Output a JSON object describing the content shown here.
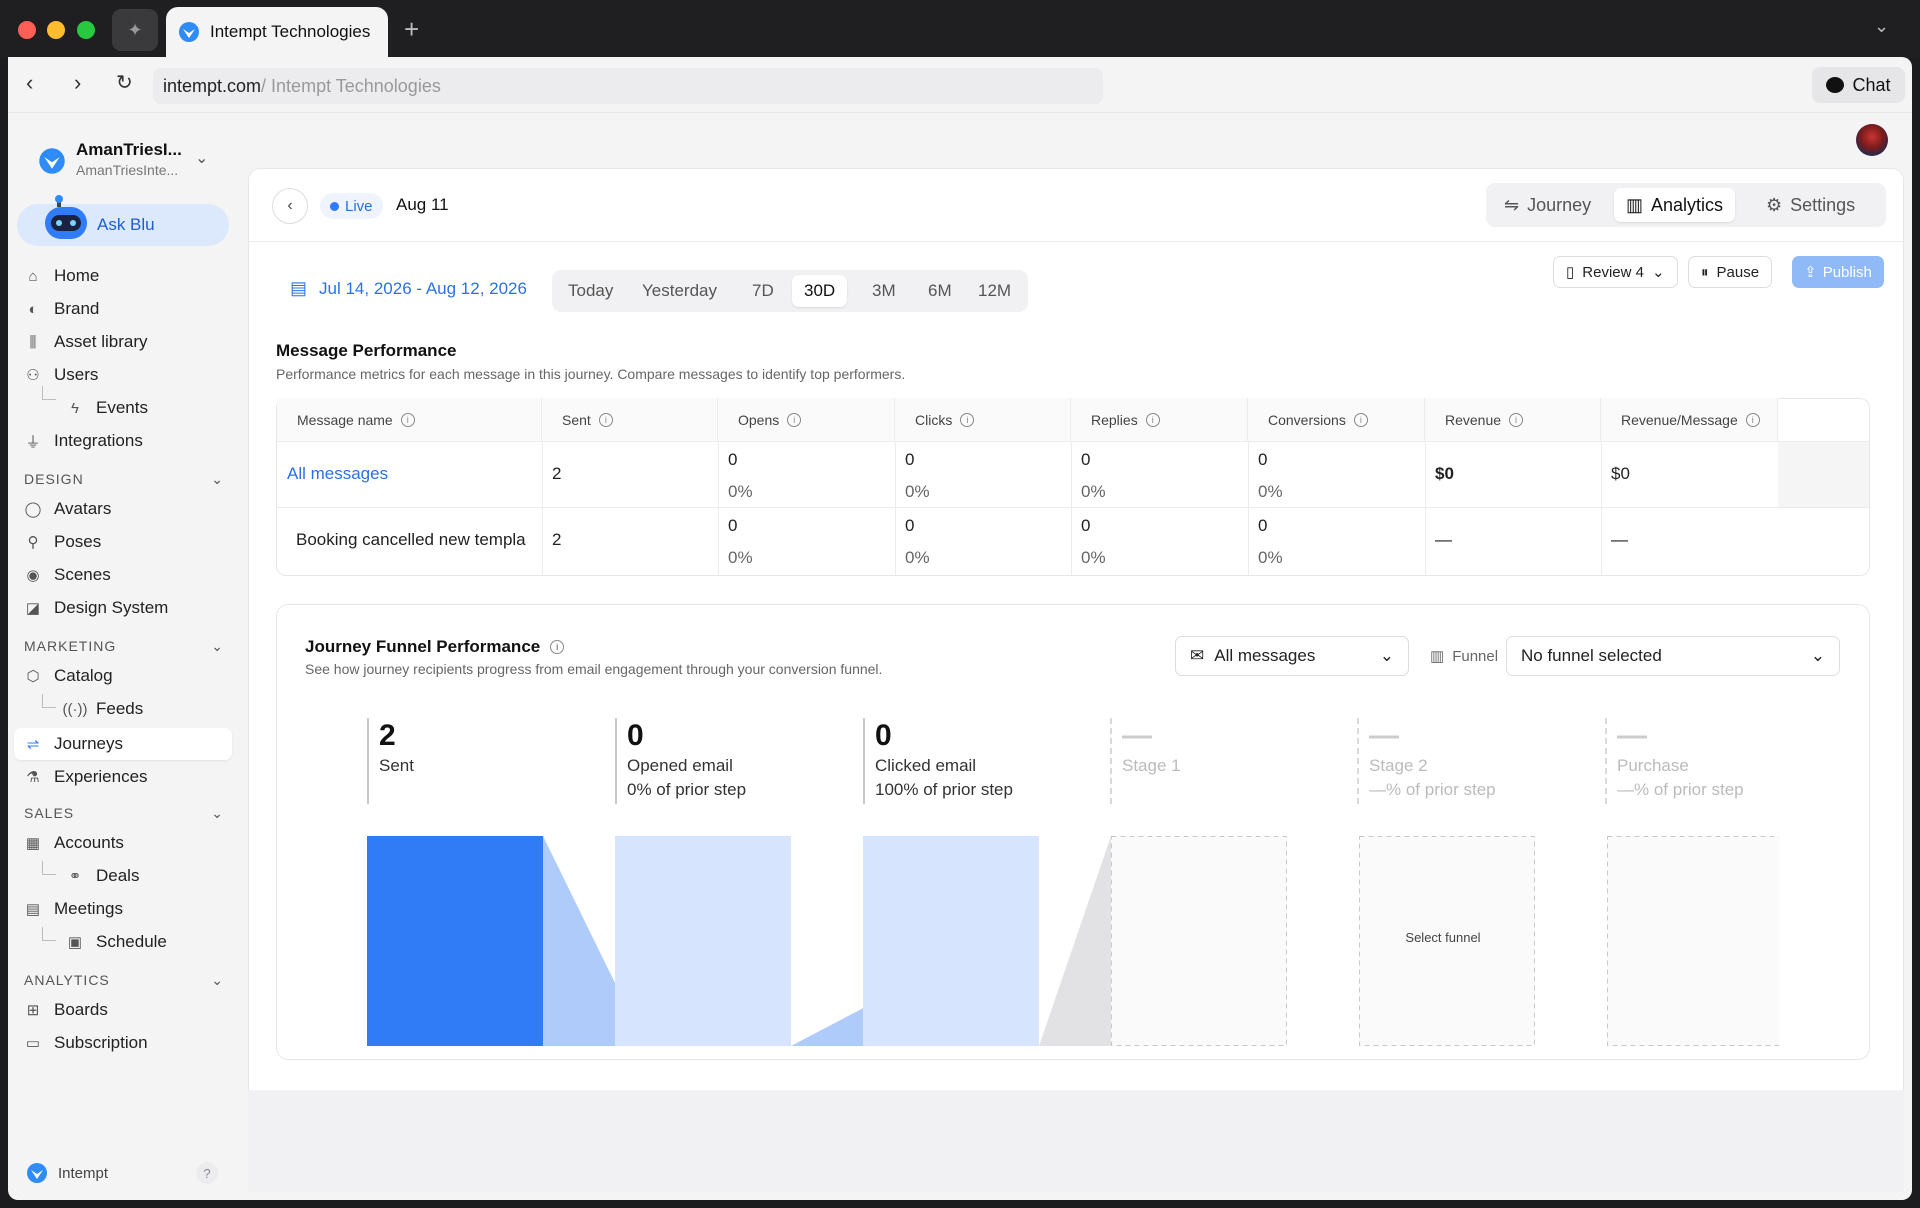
{
  "browser": {
    "tab_title": "Intempt Technologies",
    "url_domain": "intempt.com",
    "url_rest": " / Intempt Technologies",
    "chat_label": "Chat"
  },
  "workspace": {
    "name": "AmanTriesI...",
    "sub": "AmanTriesInte...",
    "ask_label": "Ask Blu"
  },
  "sidebar": {
    "items": [
      {
        "label": "Home",
        "icon": "home-icon"
      },
      {
        "label": "Brand",
        "icon": "palette-icon"
      },
      {
        "label": "Asset library",
        "icon": "library-icon"
      },
      {
        "label": "Users",
        "icon": "users-icon"
      },
      {
        "label": "Events",
        "icon": "bolt-icon"
      },
      {
        "label": "Integrations",
        "icon": "plug-icon"
      }
    ],
    "sections": {
      "design": "DESIGN",
      "marketing": "MARKETING",
      "sales": "SALES",
      "analytics": "ANALYTICS"
    },
    "design_items": [
      "Avatars",
      "Poses",
      "Scenes",
      "Design System"
    ],
    "marketing_items": [
      "Catalog",
      "Feeds",
      "Journeys",
      "Experiences"
    ],
    "sales_items": [
      "Accounts",
      "Deals",
      "Meetings",
      "Schedule"
    ],
    "analytics_items": [
      "Boards",
      "Subscription"
    ],
    "footer_brand": "Intempt",
    "help": "?"
  },
  "header": {
    "status": "Live",
    "date": "Aug 11",
    "tabs": [
      "Journey",
      "Analytics",
      "Settings"
    ],
    "active_tab": "Analytics"
  },
  "actions": {
    "review": "Review 4",
    "pause": "Pause",
    "publish": "Publish"
  },
  "filters": {
    "date_range": "Jul 14, 2026 - Aug 12, 2026",
    "ranges": [
      "Today",
      "Yesterday",
      "7D",
      "30D",
      "3M",
      "6M",
      "12M"
    ],
    "active_range": "30D"
  },
  "message_performance": {
    "title": "Message Performance",
    "subtitle": "Performance metrics for each message in this journey. Compare messages to identify top performers.",
    "columns": [
      "Message name",
      "Sent",
      "Opens",
      "Clicks",
      "Replies",
      "Conversions",
      "Revenue",
      "Revenue/Message"
    ],
    "rows": [
      {
        "name": "All messages",
        "sent": "2",
        "opens": "0",
        "opens_pct": "0%",
        "clicks": "0",
        "clicks_pct": "0%",
        "replies": "0",
        "replies_pct": "0%",
        "conversions": "0",
        "conversions_pct": "0%",
        "revenue": "$0",
        "rev_per_msg": "$0"
      },
      {
        "name": "Booking cancelled new templa",
        "sent": "2",
        "opens": "0",
        "opens_pct": "0%",
        "clicks": "0",
        "clicks_pct": "0%",
        "replies": "0",
        "replies_pct": "0%",
        "conversions": "0",
        "conversions_pct": "0%",
        "revenue": "—",
        "rev_per_msg": "—"
      }
    ]
  },
  "funnel": {
    "title": "Journey Funnel Performance",
    "subtitle": "See how journey recipients progress from email engagement through your conversion funnel.",
    "message_select": "All messages",
    "funnel_label": "Funnel",
    "funnel_select": "No funnel selected",
    "select_funnel_text": "Select funnel",
    "stages": [
      {
        "value": "2",
        "label": "Sent",
        "sub": ""
      },
      {
        "value": "0",
        "label": "Opened email",
        "sub": "0% of prior step"
      },
      {
        "value": "0",
        "label": "Clicked email",
        "sub": "100% of prior step"
      },
      {
        "value": "—",
        "label": "Stage 1",
        "sub": ""
      },
      {
        "value": "—",
        "label": "Stage 2",
        "sub": "—% of prior step"
      },
      {
        "value": "—",
        "label": "Purchase",
        "sub": "—% of prior step"
      }
    ]
  },
  "colors": {
    "accent": "#2f7cf6",
    "bar_primary": "#2f7cf6",
    "bar_light": "#d6e4fd",
    "connector": "#aecbfa"
  }
}
